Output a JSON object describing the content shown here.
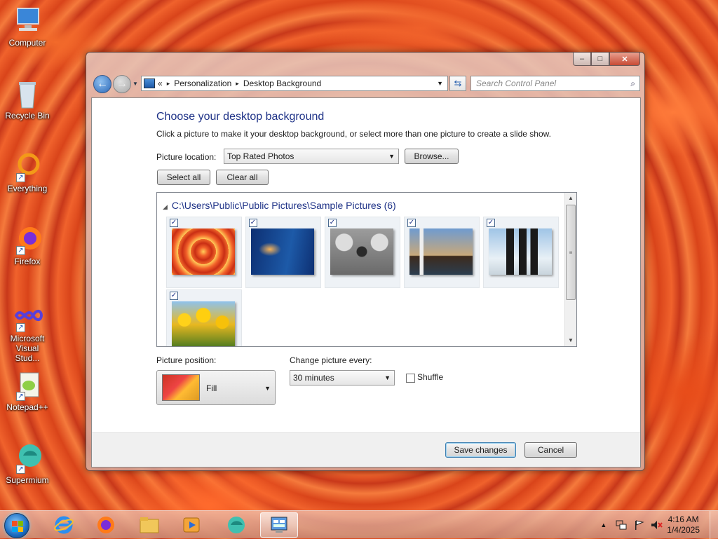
{
  "desktop": {
    "icons": [
      {
        "label": "Computer"
      },
      {
        "label": "Recycle Bin"
      },
      {
        "label": "Everything"
      },
      {
        "label": "Firefox"
      },
      {
        "label": "Microsoft Visual Stud..."
      },
      {
        "label": "Notepad++"
      },
      {
        "label": "Supermium"
      }
    ]
  },
  "window": {
    "controls": {
      "minimize": "–",
      "maximize": "□",
      "close": "✕"
    },
    "nav": {
      "back_icon": "←",
      "forward_icon": "→",
      "breadcrumb_prefix": "«",
      "breadcrumb": [
        "Personalization",
        "Desktop Background"
      ],
      "breadcrumb_sep": "▸",
      "refresh_icon": "⇆",
      "search_placeholder": "Search Control Panel",
      "search_icon": "⌕"
    },
    "content": {
      "title": "Choose your desktop background",
      "description": "Click a picture to make it your desktop background, or select more than one picture to create a slide show.",
      "picture_location_label": "Picture location:",
      "picture_location_value": "Top Rated Photos",
      "browse_label": "Browse...",
      "select_all_label": "Select all",
      "clear_all_label": "Clear all",
      "gallery": {
        "folder_label": "C:\\Users\\Public\\Public Pictures\\Sample Pictures (6)",
        "collapse_icon": "◢",
        "pictures": [
          {
            "name": "chrysanthemum",
            "checked": true
          },
          {
            "name": "jellyfish",
            "checked": true
          },
          {
            "name": "koala",
            "checked": true
          },
          {
            "name": "lighthouse",
            "checked": true
          },
          {
            "name": "penguins",
            "checked": true
          },
          {
            "name": "tulips",
            "checked": true
          }
        ]
      },
      "picture_position_label": "Picture position:",
      "picture_position_value": "Fill",
      "change_picture_label": "Change picture every:",
      "change_picture_value": "30 minutes",
      "shuffle_label": "Shuffle",
      "shuffle_checked": false,
      "save_label": "Save changes",
      "cancel_label": "Cancel"
    }
  },
  "taskbar": {
    "apps": [
      "internet-explorer",
      "firefox",
      "file-explorer",
      "media-player",
      "supermium",
      "control-panel"
    ],
    "active_app": "control-panel",
    "tray_expand": "▲",
    "clock_time": "4:16 AM",
    "clock_date": "1/4/2025"
  }
}
